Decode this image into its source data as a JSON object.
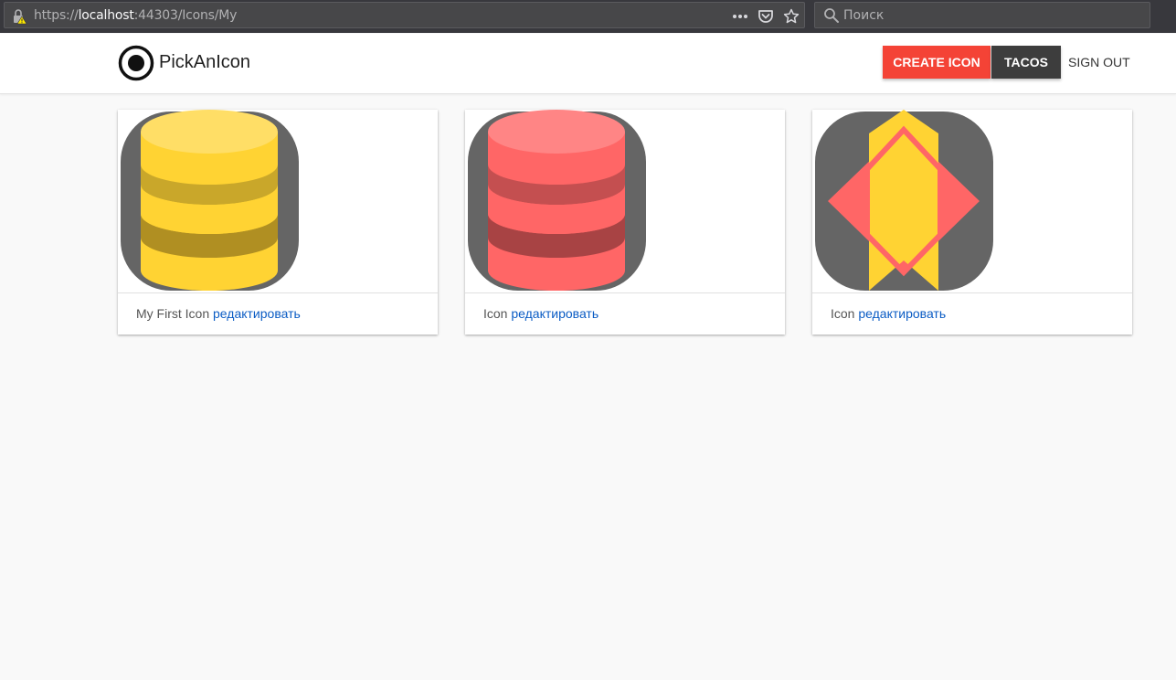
{
  "browser": {
    "url_scheme": "https://",
    "url_host": "localhost",
    "url_rest": ":44303/Icons/My",
    "search_placeholder": "Поиск"
  },
  "header": {
    "brand": "PickAnIcon",
    "create_label": "CREATE ICON",
    "tacos_label": "TACOS",
    "signout_label": "SIGN OUT"
  },
  "cards": [
    {
      "name": "My First Icon",
      "edit_label": "редактировать",
      "icon": "database-icon",
      "fill": "#ffd333",
      "rings": "#c9a72a"
    },
    {
      "name": "Icon",
      "edit_label": "редактировать",
      "icon": "database-icon",
      "fill": "#ff6666",
      "rings": "#c44f50"
    },
    {
      "name": "Icon",
      "edit_label": "редактировать",
      "icon": "diamond-ribbon-icon",
      "fill": "#ffd333",
      "rings": "#ff6666"
    }
  ],
  "colors": {
    "create_button": "#f44336",
    "tacos_button": "#3d3d3d",
    "link": "#0b5cc4",
    "icon_background": "#656565"
  }
}
